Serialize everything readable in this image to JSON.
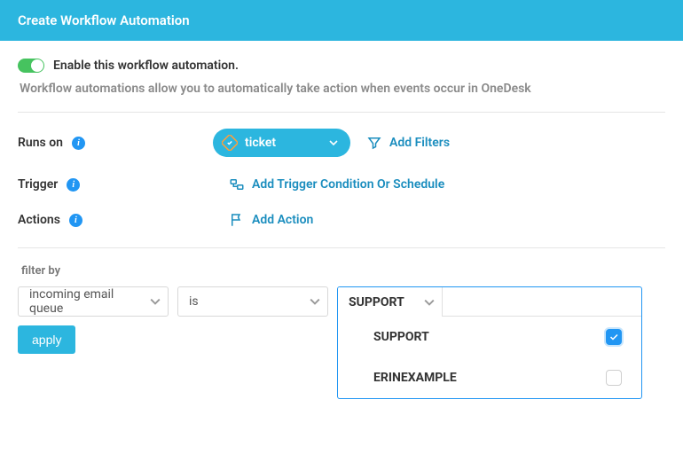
{
  "header": {
    "title": "Create Workflow Automation"
  },
  "enable": {
    "label": "Enable this workflow automation."
  },
  "description": "Workflow automations allow you to automatically take action when events occur in OneDesk",
  "runsOn": {
    "label": "Runs on",
    "ticketLabel": "ticket",
    "addFilters": "Add Filters"
  },
  "trigger": {
    "label": "Trigger",
    "addCondition": "Add Trigger Condition Or Schedule"
  },
  "actions": {
    "label": "Actions",
    "addAction": "Add Action"
  },
  "filter": {
    "label": "filter by",
    "field": "incoming email queue",
    "operator": "is",
    "value": "SUPPORT",
    "options": [
      {
        "label": "SUPPORT",
        "checked": true
      },
      {
        "label": "ERINEXAMPLE",
        "checked": false
      }
    ],
    "apply": "apply"
  }
}
